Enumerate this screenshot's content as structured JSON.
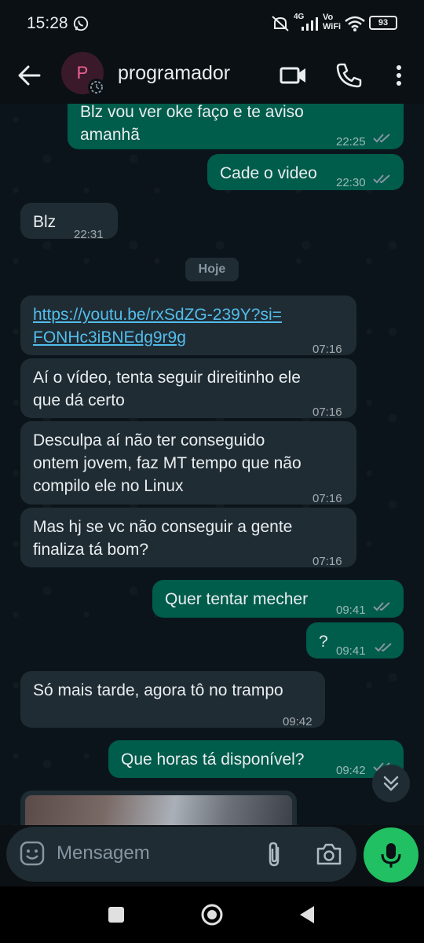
{
  "status_bar": {
    "time": "15:28",
    "network_label": "4G",
    "vowifi_label_top": "Vo",
    "vowifi_label_bottom": "WiFi",
    "battery": "93"
  },
  "header": {
    "avatar_letter": "P",
    "contact_name": "programador"
  },
  "messages": [
    {
      "dir": "out",
      "text_line1": "Blz vou ver oke faço e te aviso",
      "text_line2": "amanhã",
      "time": "22:25",
      "status": "read"
    },
    {
      "dir": "out",
      "text": "Cade o video",
      "time": "22:30",
      "status": "read"
    },
    {
      "dir": "in",
      "text": "Blz",
      "time": "22:31"
    },
    {
      "dir": "in",
      "link_line1": "https://youtu.be/rxSdZG-239Y?si=",
      "link_line2": "FONHc3iBNEdg9r9g",
      "time": "07:16"
    },
    {
      "dir": "in",
      "text_line1": "Aí o vídeo, tenta seguir direitinho ele",
      "text_line2": "que dá certo",
      "time": "07:16"
    },
    {
      "dir": "in",
      "text_line1": "Desculpa aí não ter conseguido",
      "text_line2": "ontem jovem, faz MT tempo que não",
      "text_line3": "compilo ele no Linux",
      "time": "07:16"
    },
    {
      "dir": "in",
      "text_line1": "Mas hj se vc não conseguir a gente",
      "text_line2": "finaliza tá bom?",
      "time": "07:16"
    },
    {
      "dir": "out",
      "text": "Quer tentar mecher",
      "time": "09:41",
      "status": "read"
    },
    {
      "dir": "out",
      "text": "?",
      "time": "09:41",
      "status": "read"
    },
    {
      "dir": "in",
      "text": "Só mais tarde, agora tô no trampo",
      "time": "09:42"
    },
    {
      "dir": "out",
      "text": "Que horas tá disponível?",
      "time": "09:42",
      "status": "read"
    }
  ],
  "date_chip": "Hoje",
  "composer": {
    "placeholder": "Mensagem"
  },
  "colors": {
    "incoming_bubble": "#1f2c34",
    "outgoing_bubble": "#005c4b",
    "accent_green": "#21c063",
    "link": "#53bdeb",
    "read_ticks": "#8696a0"
  },
  "icons": [
    "back-arrow-icon",
    "video-call-icon",
    "phone-icon",
    "more-vert-icon",
    "emoji-icon",
    "attach-icon",
    "camera-icon",
    "mic-icon",
    "scroll-down-icon",
    "whatsapp-icon",
    "mute-icon",
    "signal-icon",
    "wifi-icon",
    "battery-icon",
    "nav-recents-icon",
    "nav-home-icon",
    "nav-back-icon"
  ]
}
